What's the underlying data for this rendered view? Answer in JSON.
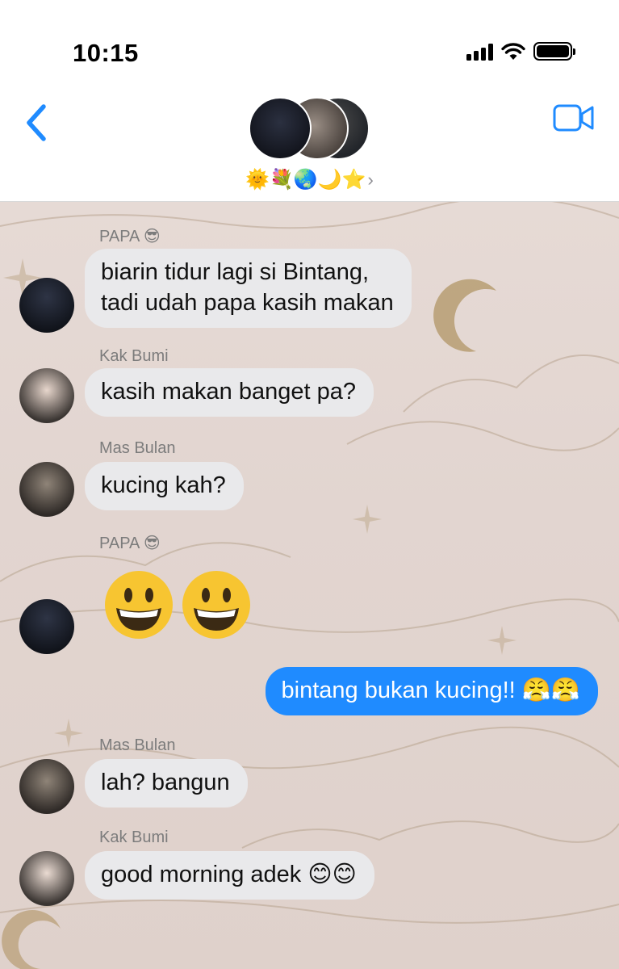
{
  "status_bar": {
    "time": "10:15"
  },
  "header": {
    "group_name_emojis": "🌞💐🌏🌙⭐",
    "chevron": "›",
    "back_icon": "chevron-left-icon",
    "video_icon": "video-camera-icon"
  },
  "colors": {
    "accent": "#1f8bff",
    "incoming_bubble": "#e9e9eb",
    "chat_background": "#e2d5d0"
  },
  "messages": [
    {
      "sender": "PAPA 😎",
      "text": "biarin tidur lagi si Bintang,\ntadi udah papa kasih makan"
    },
    {
      "sender": "Kak Bumi",
      "text": "kasih makan banget pa?"
    },
    {
      "sender": "Mas Bulan",
      "text": "kucing kah?"
    },
    {
      "sender": "PAPA 😎",
      "text": "😃😃"
    },
    {
      "sender": "",
      "text": "bintang bukan kucing!! 😤😤",
      "outgoing": true
    },
    {
      "sender": "Mas Bulan",
      "text": "lah? bangun"
    },
    {
      "sender": "Kak Bumi",
      "text": "good morning adek 😊😊"
    }
  ]
}
